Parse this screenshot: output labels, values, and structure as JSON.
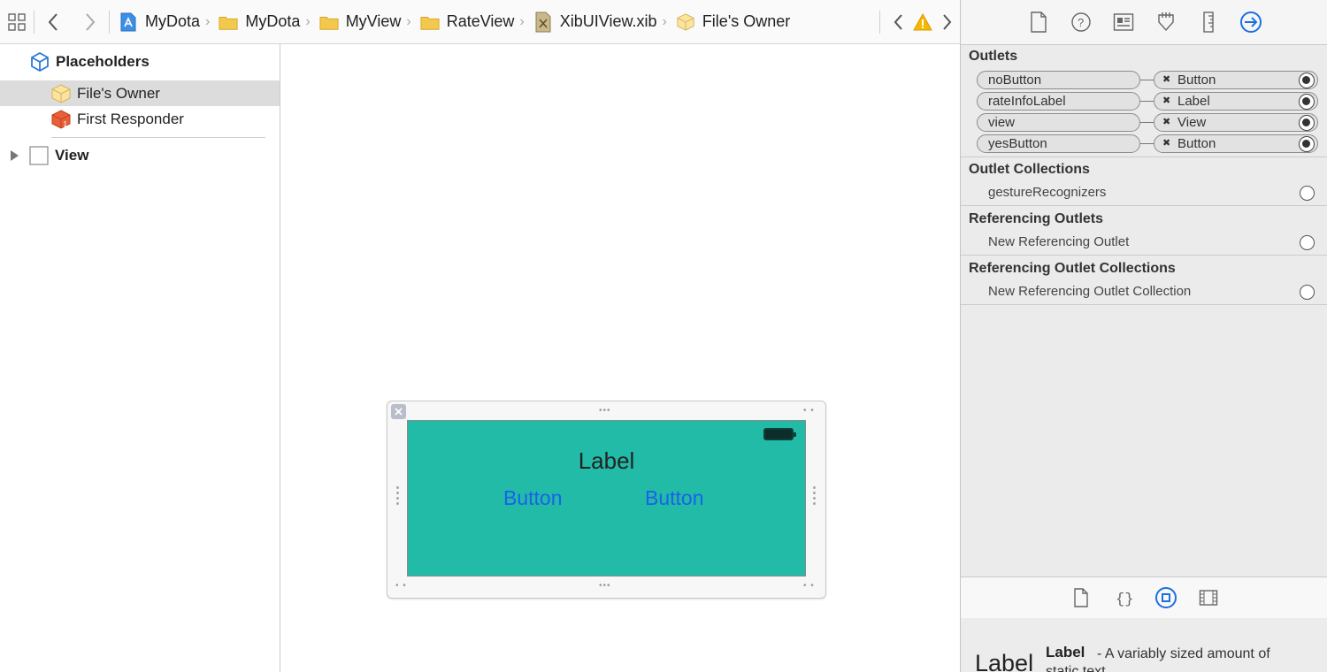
{
  "breadcrumbs": [
    {
      "label": "MyDota",
      "icon": "project-icon"
    },
    {
      "label": "MyDota",
      "icon": "folder-icon"
    },
    {
      "label": "MyView",
      "icon": "folder-icon"
    },
    {
      "label": "RateView",
      "icon": "folder-icon"
    },
    {
      "label": "XibUIView.xib",
      "icon": "xib-file-icon"
    },
    {
      "label": "File's Owner",
      "icon": "files-owner-cube-icon"
    }
  ],
  "outline": {
    "placeholders_header": "Placeholders",
    "files_owner": "File's Owner",
    "first_responder": "First Responder",
    "view": "View"
  },
  "canvas": {
    "label_text": "Label",
    "button_left": "Button",
    "button_right": "Button",
    "view_color": "#22bba8",
    "button_color": "#1a62e8"
  },
  "inspector": {
    "outlets_title": "Outlets",
    "outlets": [
      {
        "name": "noButton",
        "target": "Button"
      },
      {
        "name": "rateInfoLabel",
        "target": "Label"
      },
      {
        "name": "view",
        "target": "View"
      },
      {
        "name": "yesButton",
        "target": "Button"
      }
    ],
    "outlet_collections_title": "Outlet Collections",
    "gesture_recognizers": "gestureRecognizers",
    "referencing_outlets_title": "Referencing Outlets",
    "new_referencing_outlet": "New Referencing Outlet",
    "referencing_outlet_collections_title": "Referencing Outlet Collections",
    "new_referencing_outlet_collection": "New Referencing Outlet Collection",
    "active_tab_color": "#1a70e0"
  },
  "library": {
    "preview": "Label",
    "name": "Label",
    "description": "- A variably sized amount of static text."
  }
}
